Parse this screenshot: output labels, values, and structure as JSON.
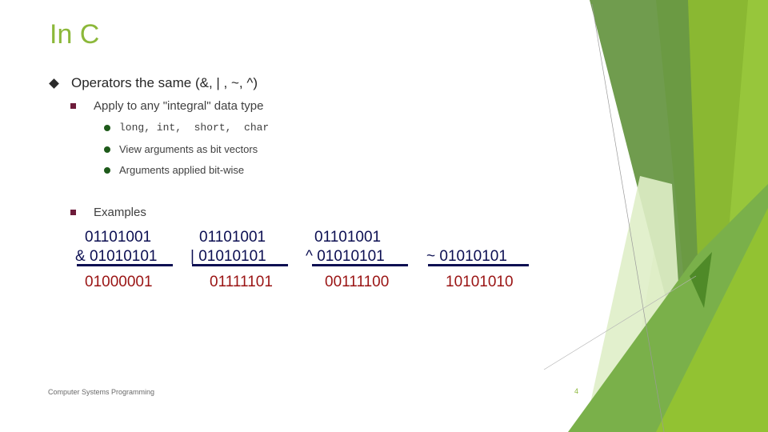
{
  "slide": {
    "title": "In C",
    "bullets": {
      "level1": "Operators the same (&, | , ~, ^)",
      "apply": "Apply to any \"integral\" data type",
      "types": "long, int,  short,  char",
      "view": "View arguments as bit vectors",
      "applied": "Arguments applied bit-wise",
      "examples": "Examples"
    },
    "examples": [
      {
        "operand_a": "01101001",
        "operand_b": "& 01010101",
        "result": "01000001"
      },
      {
        "operand_a": "01101001",
        "operand_b": "| 01010101",
        "result": "01111101"
      },
      {
        "operand_a": "01101001",
        "operand_b": "^ 01010101",
        "result": "00111100"
      },
      {
        "operand_a": "",
        "operand_b": "~ 01010101",
        "result": "10101010"
      }
    ],
    "footer": "Computer Systems Programming",
    "page_number": "4"
  },
  "theme": {
    "accent": "#8cb83a",
    "result_color": "#9a1414",
    "operand_color": "#0c0f52"
  }
}
